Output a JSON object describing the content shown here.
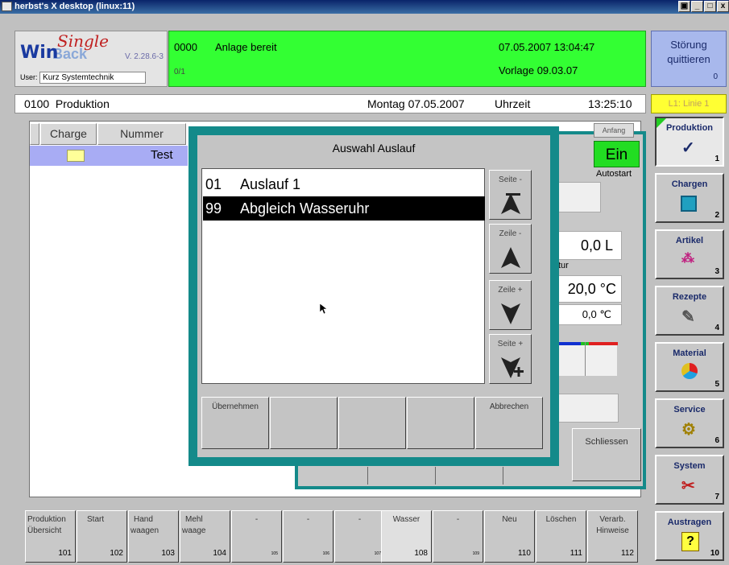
{
  "window": {
    "title": "herbst's X desktop (linux:11)",
    "controls": [
      "▣",
      "_",
      "□",
      "x"
    ]
  },
  "logo": {
    "win": "Win",
    "back": "Back",
    "single": "Single",
    "version": "V. 2.28.6-3",
    "user_label": "User:",
    "user_value": "Kurz Systemtechnik"
  },
  "status": {
    "code": "0000",
    "message": "Anlage bereit",
    "datetime": "07.05.2007 13:04:47",
    "vorlage": "Vorlage 09.03.07",
    "fraction": "0/1",
    "color": "#33ff33"
  },
  "stoerung": {
    "line1": "Störung",
    "line2": "quittieren",
    "count": "0"
  },
  "infobar": {
    "left": "0100  Produktion",
    "date": "Montag 07.05.2007",
    "uhrzeit_label": "Uhrzeit",
    "time": "13:25:10"
  },
  "linie": "L1: Linie 1",
  "list": {
    "headers": [
      "Charge",
      "Nummer"
    ],
    "row_name": "Test"
  },
  "bgpanel": {
    "ein": "Ein",
    "autostart": "Autostart",
    "val1": "0,0 L",
    "tur": "tur",
    "val2": "20,0 °C",
    "val3": "0,0 ℃",
    "schliessen": "Schliessen",
    "anfang": "Anfang"
  },
  "dialog": {
    "title": "Auswahl Auslauf",
    "items": [
      {
        "num": "01",
        "text": "Auslauf 1"
      },
      {
        "num": "99",
        "text": "Abgleich Wasseruhr"
      }
    ],
    "side_buttons": [
      "Seite -",
      "Zeile -",
      "Zeile +",
      "Seite +"
    ],
    "bottom_buttons": [
      "Übernehmen",
      "",
      "",
      "",
      "Abbrechen"
    ]
  },
  "right_menu": [
    {
      "label": "Produktion",
      "num": "1",
      "icon": "checkmark-icon"
    },
    {
      "label": "Chargen",
      "num": "2",
      "icon": "grid-icon"
    },
    {
      "label": "Artikel",
      "num": "3",
      "icon": "tree-icon"
    },
    {
      "label": "Rezepte",
      "num": "4",
      "icon": "book-icon"
    },
    {
      "label": "Material",
      "num": "5",
      "icon": "pie-icon"
    },
    {
      "label": "Service",
      "num": "6",
      "icon": "gears-icon"
    },
    {
      "label": "System",
      "num": "7",
      "icon": "tools-icon"
    },
    {
      "label": "Austragen",
      "num": "10",
      "icon": "question-icon"
    }
  ],
  "bottom_buttons": [
    {
      "label": "Produktion\nÜbersicht",
      "num": "101"
    },
    {
      "label": "Start",
      "num": "102"
    },
    {
      "label": "Hand\nwaagen",
      "num": "103"
    },
    {
      "label": "Mehl\nwaage",
      "num": "104"
    },
    {
      "label": "-",
      "num": "105"
    },
    {
      "label": "-",
      "num": "106"
    },
    {
      "label": "-",
      "num": "107"
    },
    {
      "label": "Wasser",
      "num": "108"
    },
    {
      "label": "-",
      "num": "109"
    },
    {
      "label": "Neu",
      "num": "110"
    },
    {
      "label": "Löschen",
      "num": "111"
    },
    {
      "label": "Verarb.\nHinweise",
      "num": "112"
    }
  ]
}
